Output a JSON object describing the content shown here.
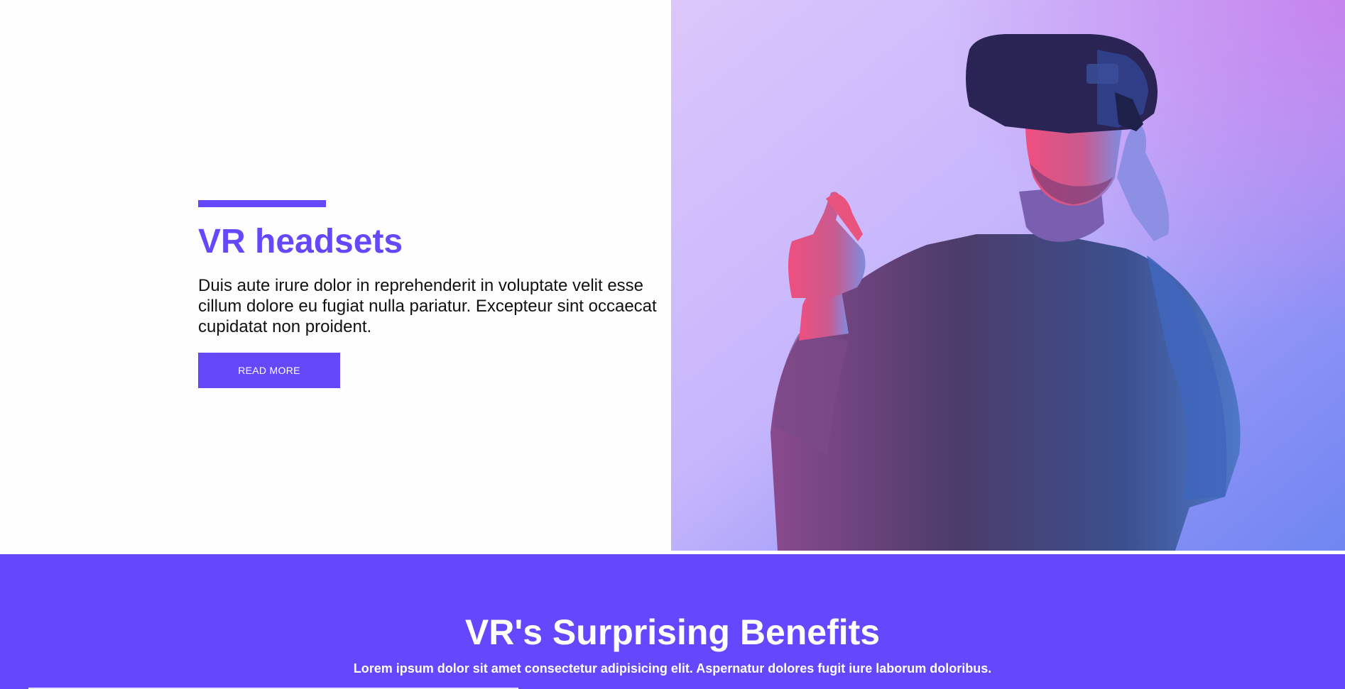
{
  "hero": {
    "title": "VR headsets",
    "description": "Duis aute irure dolor in reprehenderit in voluptate velit esse cillum dolore eu fugiat nulla pariatur. Excepteur sint occaecat cupidatat non proident.",
    "button_label": "READ MORE",
    "image_subject": "man-wearing-vr-headset-photo"
  },
  "benefits": {
    "title": "VR's Surprising Benefits",
    "subtitle": "Lorem ipsum dolor sit amet consectetur adipisicing elit. Aspernatur dolores fugit iure laborum doloribus."
  },
  "colors": {
    "accent": "#6548f9",
    "benefits_bg": "#6548fe",
    "text": "#111111",
    "white": "#ffffff"
  }
}
